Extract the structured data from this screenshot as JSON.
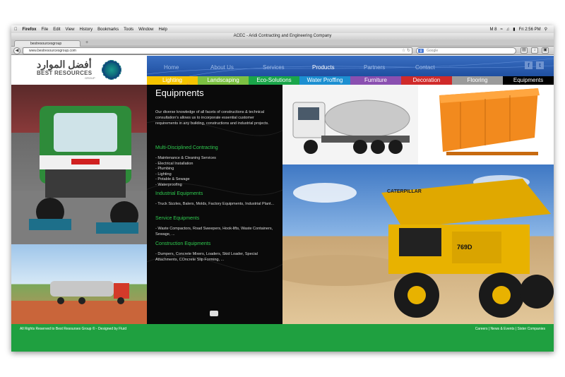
{
  "menubar": {
    "items": [
      "Firefox",
      "File",
      "Edit",
      "View",
      "History",
      "Bookmarks",
      "Tools",
      "Window",
      "Help"
    ],
    "status": "M 8",
    "clock": "Fri 2:56 PM"
  },
  "window": {
    "title": "ACEC - Aridi Contracting and Engineering Company"
  },
  "tabs": [
    {
      "label": "bestresourcesgroup"
    }
  ],
  "toolbar": {
    "url": "www.bestresourcesgroup.com",
    "search_placeholder": "Google"
  },
  "site": {
    "logo": {
      "arabic": "أفضل الموارد",
      "english": "BEST RESOURCES",
      "group": "GROUP"
    },
    "nav": [
      {
        "label": "Home"
      },
      {
        "label": "About Us"
      },
      {
        "label": "Services"
      },
      {
        "label": "Products"
      },
      {
        "label": "Partners"
      },
      {
        "label": "Contact"
      }
    ],
    "nav_active": "Products",
    "subnav": [
      {
        "label": "Lighting",
        "color": "#f5c400"
      },
      {
        "label": "Landscaping",
        "color": "#7cc142"
      },
      {
        "label": "Eco-Solutions",
        "color": "#1aa64a"
      },
      {
        "label": "Water Proffing",
        "color": "#1c8fd1"
      },
      {
        "label": "Furniture",
        "color": "#8a4fb0"
      },
      {
        "label": "Decoration",
        "color": "#d02a2a"
      },
      {
        "label": "Flooring",
        "color": "#9b9b9b"
      },
      {
        "label": "Equipments",
        "color": "#000000"
      }
    ],
    "panel": {
      "heading": "Equipments",
      "intro": "Our diverse knowledge of all facets of constructions & technical consultation's allows us to incorporate essential customer requirements in any building, constructions and industrial projects.",
      "sections": [
        {
          "title": "Multi-Disciplined Contracting",
          "text": "- Maintenance & Cleaning Services\n- Electrical Installation\n- Plumbing\n- Lighting\n- Potable & Sewage\n- Waterproofing"
        },
        {
          "title": "Industrial Equipments",
          "text": "- Truck Sizzles, Balers, Molds, Factory Equipments, Industrial Plant..."
        },
        {
          "title": "Service Equipments",
          "text": "- Waste Compactors, Road Sweepers, Hook-lifts, Waste Containers, Sewage, ..."
        },
        {
          "title": "Construction Equipments",
          "text": "- Dumpers, Concrete Mixers, Loaders, Skid Loader, Special Attachments, COncrete Slip Forming, ..."
        }
      ]
    },
    "truck_label": "CATERPILLAR",
    "truck_number": "769D",
    "footer": {
      "left": "All Rights Reserved to Best Resourses Group © - Designed by Fluid",
      "right": "Careers | News & Events | Sister Companies"
    }
  }
}
